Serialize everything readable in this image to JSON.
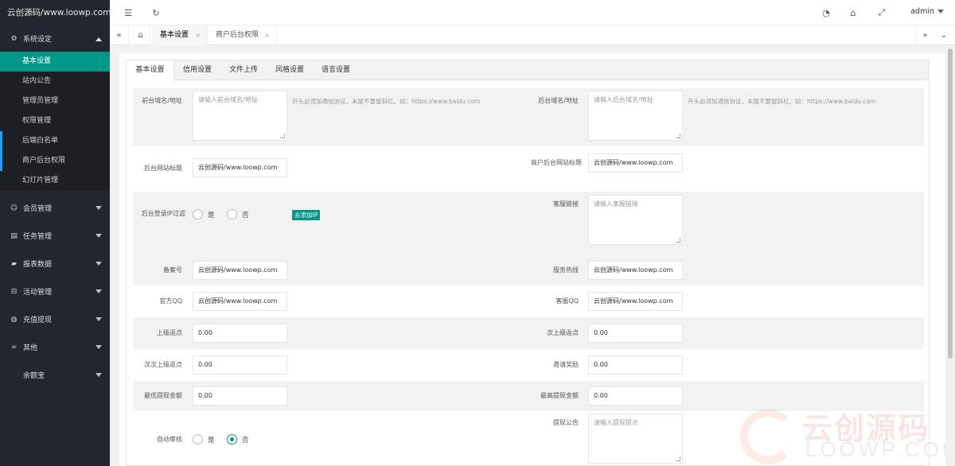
{
  "logo": "云创源码/www.loowp.com",
  "sidebar": {
    "group_system": "系统设定",
    "sub": [
      "基本设置",
      "站内公告",
      "管理员管理",
      "权限管理",
      "后端白名单",
      "商户后台权限",
      "幻灯片管理"
    ],
    "groups": [
      "会员管理",
      "任务管理",
      "报表数据",
      "活动管理",
      "充值提现",
      "其他",
      "余额宝"
    ]
  },
  "header": {
    "user": "admin"
  },
  "tabs": [
    {
      "label": "基本设置",
      "close": "×"
    },
    {
      "label": "商户后台权限",
      "close": "×"
    }
  ],
  "panel_tabs": [
    "基本设置",
    "信用设置",
    "文件上传",
    "风格设置",
    "语言设置"
  ],
  "form": {
    "front_domain_label": "前台域名/地址",
    "front_domain_placeholder": "请输入前台域名/地址",
    "front_domain_hint": "开头必须加通信协议，末尾不要留斜杠。如：https://www.baidu.com",
    "back_domain_label": "后台域名/地址",
    "back_domain_placeholder": "请输入后台域名/地址",
    "back_domain_hint": "开头必须加通信协议，末尾不要留斜杠。如：https://www.baidu.com",
    "site_title_label": "后台网站标题",
    "site_title_value": "云创源码/www.loowp.com",
    "merchant_title_label": "商户后台网站标题",
    "merchant_title_value": "云创源码/www.loowp.com",
    "ip_filter_label": "后台登录IP过滤",
    "yes": "是",
    "no": "否",
    "add_ip_button": "去添加IP",
    "service_link_label": "客服链接",
    "service_link_placeholder": "请输入客服链接",
    "record_label": "备案号",
    "record_value": "云创源码/www.loowp.com",
    "hotline_label": "服务热线",
    "hotline_value": "云创源码/www.loowp.com",
    "qq_label": "官方QQ",
    "qq_value": "云创源码/www.loowp.com",
    "service_qq_label": "客服QQ",
    "service_qq_value": "云创源码/www.loowp.com",
    "upper_rebate_label": "上级返点",
    "upper_rebate_value": "0.00",
    "second_rebate_label": "次上级返点",
    "second_rebate_value": "0.00",
    "third_rebate_label": "次次上级返点",
    "third_rebate_value": "0.00",
    "invite_reward_label": "邀请奖励",
    "invite_reward_value": "0.00",
    "min_withdraw_label": "最低提现金额",
    "min_withdraw_value": "0.00",
    "max_withdraw_label": "最高提现金额",
    "max_withdraw_value": "0.00",
    "auto_review_label": "自动审核",
    "withdraw_notice_label": "提现公告",
    "withdraw_notice_placeholder": "请输入提现提示"
  },
  "watermark": {
    "title": "云创源码",
    "sub": "LOOWP.COM"
  },
  "colors": {
    "sidebar": "#23262e",
    "accent": "#009688"
  }
}
